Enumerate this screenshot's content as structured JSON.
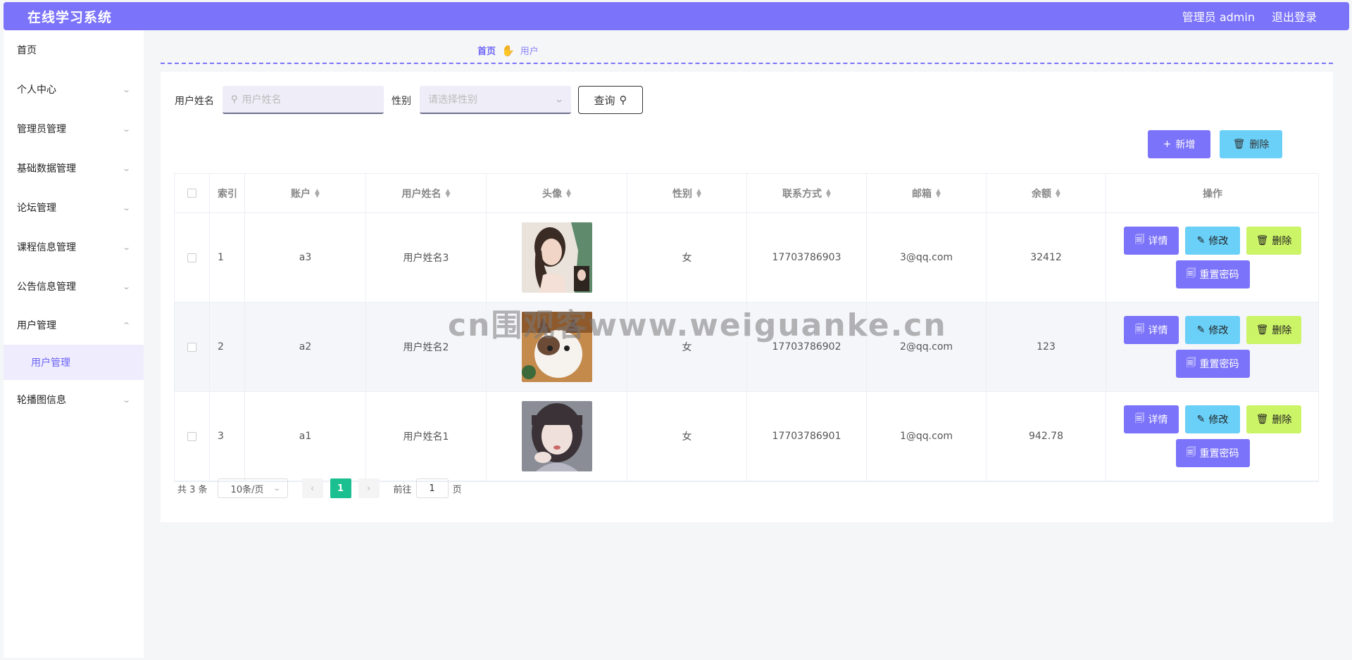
{
  "header": {
    "app_title": "在线学习系统",
    "user_label": "管理员 admin",
    "logout_label": "退出登录"
  },
  "sidebar": {
    "items": [
      {
        "label": "首页",
        "has_arrow": false
      },
      {
        "label": "个人中心",
        "has_arrow": true
      },
      {
        "label": "管理员管理",
        "has_arrow": true
      },
      {
        "label": "基础数据管理",
        "has_arrow": true
      },
      {
        "label": "论坛管理",
        "has_arrow": true
      },
      {
        "label": "课程信息管理",
        "has_arrow": true
      },
      {
        "label": "公告信息管理",
        "has_arrow": true
      },
      {
        "label": "用户管理",
        "has_arrow": true,
        "expanded": true
      },
      {
        "label": "轮播图信息",
        "has_arrow": true
      }
    ],
    "active_sub": "用户管理"
  },
  "breadcrumb": {
    "home": "首页",
    "separator": "✋",
    "current": "用户"
  },
  "search": {
    "name_label": "用户姓名",
    "name_placeholder": "用户姓名",
    "gender_label": "性别",
    "gender_placeholder": "请选择性别",
    "query_label": "查询"
  },
  "actions": {
    "add_label": "新增",
    "delete_label": "删除"
  },
  "table": {
    "columns": [
      "",
      "索引",
      "账户",
      "用户姓名",
      "头像",
      "性别",
      "联系方式",
      "邮箱",
      "余额",
      "操作"
    ],
    "sortable": [
      false,
      false,
      true,
      true,
      true,
      true,
      true,
      true,
      true,
      false
    ],
    "rows": [
      {
        "index": "1",
        "account": "a3",
        "name": "用户姓名3",
        "avatar": "avatar-woman-illustration",
        "gender": "女",
        "phone": "17703786903",
        "email": "3@qq.com",
        "balance": "32412"
      },
      {
        "index": "2",
        "account": "a2",
        "name": "用户姓名2",
        "avatar": "avatar-cat",
        "gender": "女",
        "phone": "17703786902",
        "email": "2@qq.com",
        "balance": "123"
      },
      {
        "index": "3",
        "account": "a1",
        "name": "用户姓名1",
        "avatar": "avatar-girl-photo",
        "gender": "女",
        "phone": "17703786901",
        "email": "1@qq.com",
        "balance": "942.78"
      }
    ],
    "row_ops": {
      "detail": "详情",
      "edit": "修改",
      "delete": "删除",
      "reset": "重置密码"
    }
  },
  "pagination": {
    "total_text": "共 3 条",
    "page_size": "10条/页",
    "current_page": "1",
    "goto_label": "前往",
    "goto_value": "1",
    "page_suffix": "页"
  },
  "watermark": "cn围观客www.weiguanke.cn",
  "colors": {
    "primary": "#7b73f9",
    "info": "#6ad0f8",
    "warning": "#ccf467",
    "pager_active": "#1cbf8f"
  }
}
